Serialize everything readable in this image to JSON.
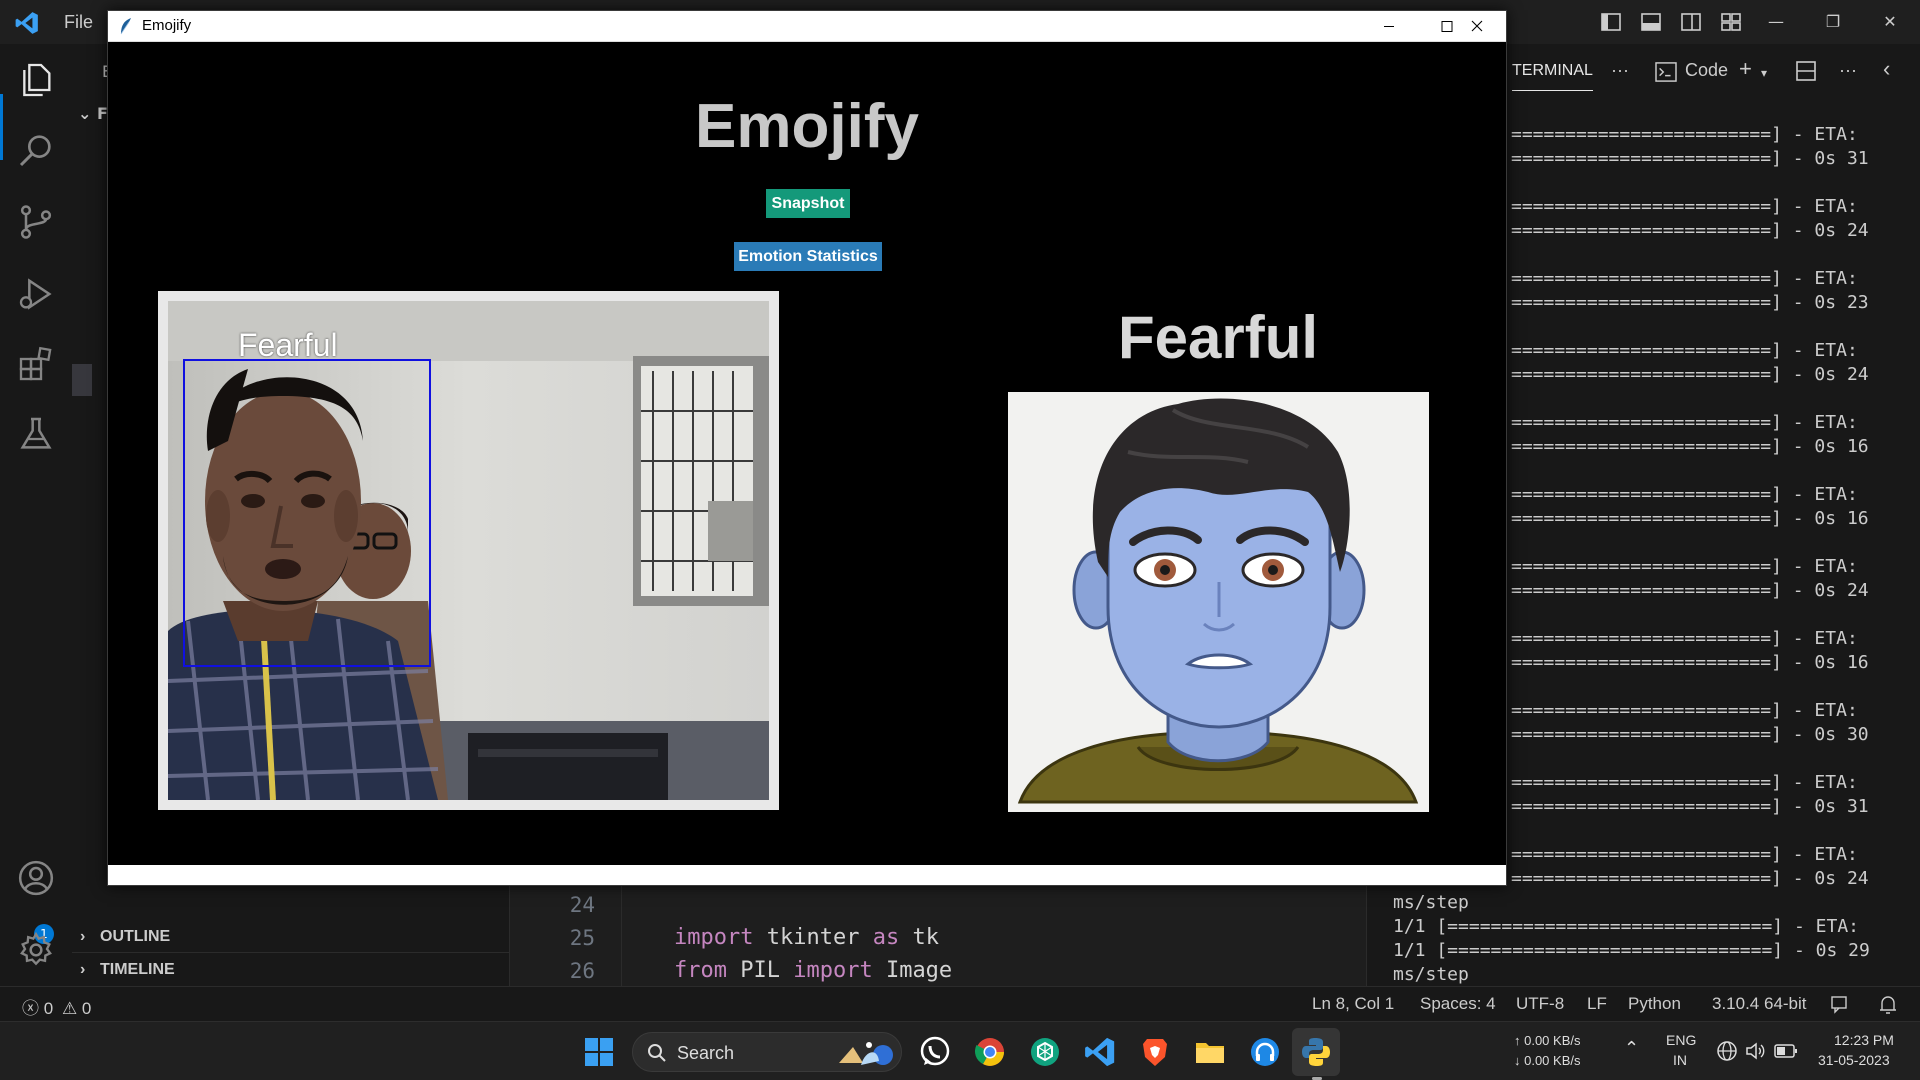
{
  "vscode": {
    "menu_file": "File",
    "sidebar": {
      "outline_label": "OUTLINE",
      "timeline_label": "TIMELINE",
      "explorer_initial": "E",
      "folder_initial": "F"
    },
    "account_badge": "1",
    "editor": {
      "lines": [
        {
          "num": "24",
          "code": ""
        },
        {
          "num": "25",
          "code": "import tkinter as tk"
        },
        {
          "num": "26",
          "code": "from PIL import Image"
        }
      ]
    },
    "terminal": {
      "tab_label": "TERMINAL",
      "profile_label": "Code",
      "lines": [
        "========================] - ETA:",
        "========================] - 0s 31",
        "",
        "========================] - ETA:",
        "========================] - 0s 24",
        "",
        "========================] - ETA:",
        "========================] - 0s 23",
        "",
        "========================] - ETA:",
        "========================] - 0s 24",
        "",
        "========================] - ETA:",
        "========================] - 0s 16",
        "",
        "========================] - ETA:",
        "========================] - 0s 16",
        "",
        "========================] - ETA:",
        "========================] - 0s 24",
        "",
        "========================] - ETA:",
        "========================] - 0s 16",
        "",
        "========================] - ETA:",
        "========================] - 0s 30",
        "",
        "========================] - ETA:",
        "========================] - 0s 31",
        "",
        "========================] - ETA:",
        "========================] - 0s 24"
      ],
      "full_lines": [
        "ms/step",
        "1/1 [==============================] - ETA:",
        "1/1 [==============================] - 0s 29",
        "ms/step"
      ]
    },
    "statusbar": {
      "errors": "0",
      "warnings": "0",
      "position": "Ln 8, Col 1",
      "spaces": "Spaces: 4",
      "encoding": "UTF-8",
      "eol": "LF",
      "language": "Python",
      "interpreter": "3.10.4 64-bit"
    }
  },
  "emojify": {
    "window_title": "Emojify",
    "heading": "Emojify",
    "snapshot_button": "Snapshot",
    "stats_button": "Emotion Statistics",
    "webcam_overlay_label": "Fearful",
    "emotion_label": "Fearful",
    "face_box_color": "#1010e0"
  },
  "taskbar": {
    "search_label": "Search",
    "net_up": "↑ 0.00 KB/s",
    "net_down": "↓ 0.00 KB/s",
    "lang_1": "ENG",
    "lang_2": "IN",
    "time": "12:23 PM",
    "date": "31-05-2023"
  },
  "colors": {
    "accent": "#0078d4",
    "snapshot_btn": "#14997a",
    "stats_btn": "#2a7bb7"
  }
}
